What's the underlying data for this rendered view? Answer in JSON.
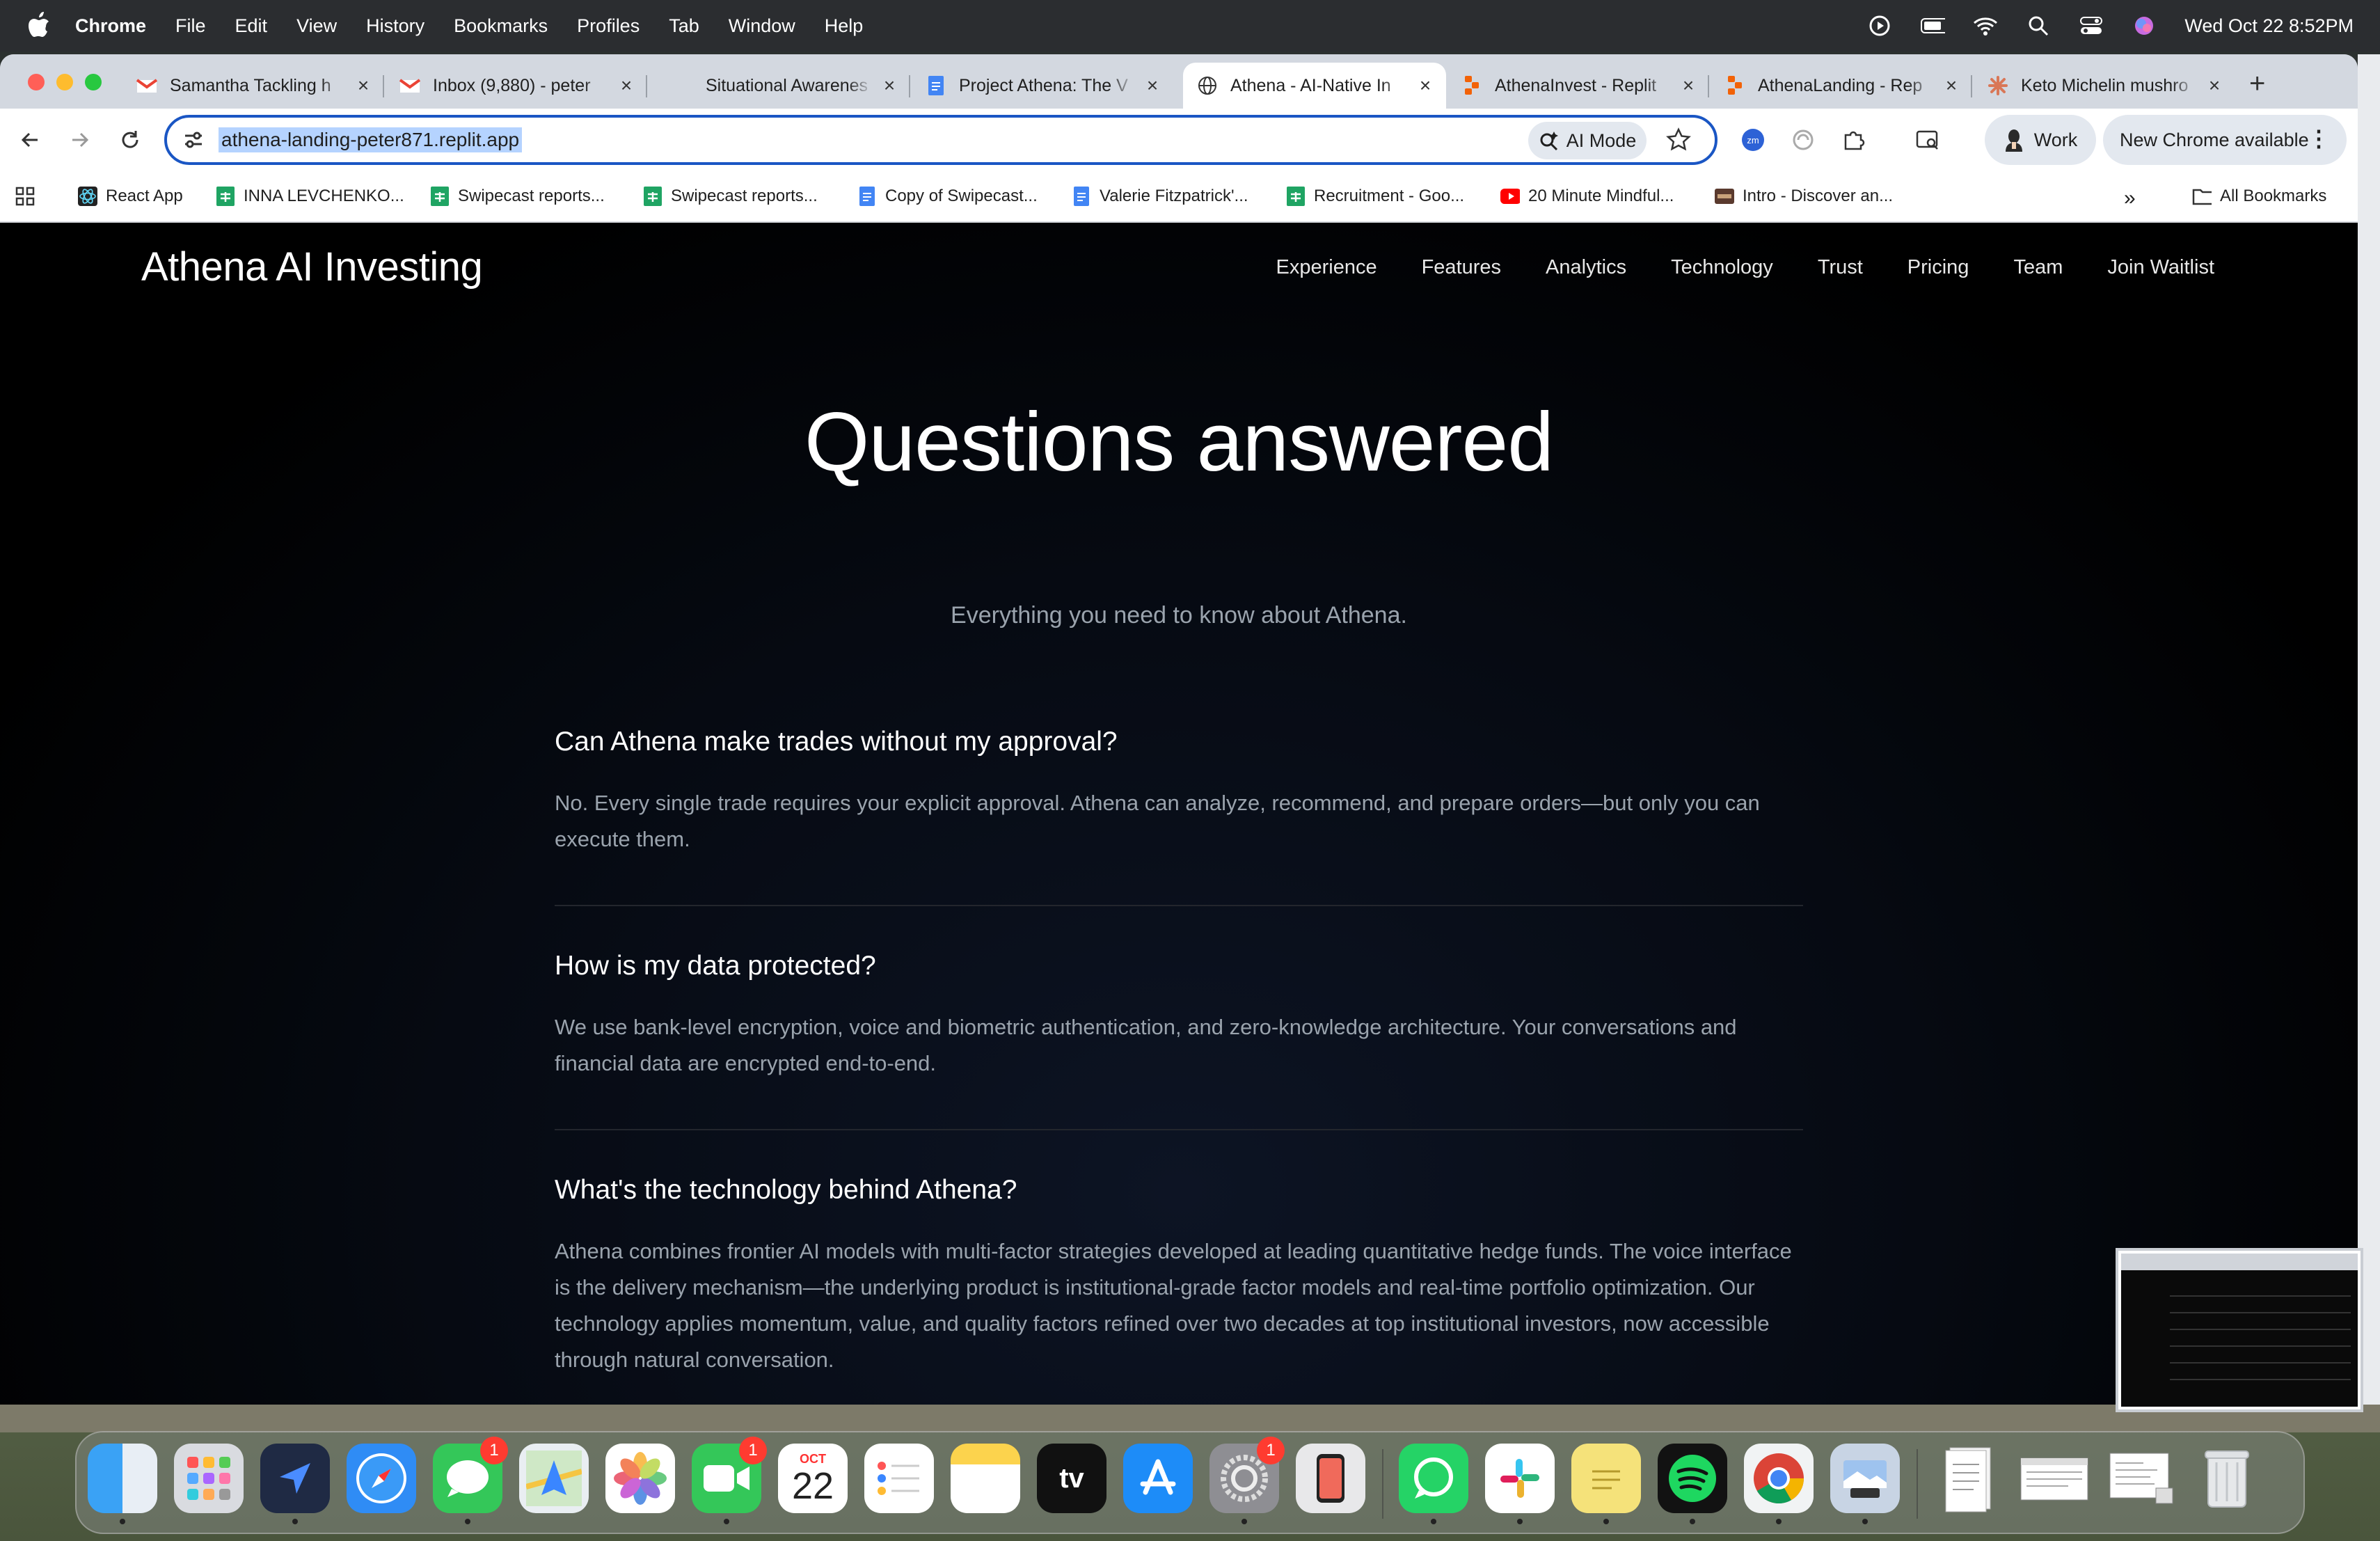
{
  "menubar": {
    "app": "Chrome",
    "items": [
      "File",
      "Edit",
      "View",
      "History",
      "Bookmarks",
      "Profiles",
      "Tab",
      "Window",
      "Help"
    ],
    "clock": "Wed Oct 22  8:52PM"
  },
  "tabs": [
    {
      "title": "Samantha Tackling h",
      "icon": "gmail-icon"
    },
    {
      "title": "Inbox (9,880) - peter",
      "icon": "gmail-icon"
    },
    {
      "title": "Situational Awarenes",
      "icon": "blank-icon"
    },
    {
      "title": "Project Athena: The V",
      "icon": "docs-icon"
    },
    {
      "title": "Athena - AI-Native In",
      "icon": "globe-icon"
    },
    {
      "title": "AthenaInvest - Replit",
      "icon": "replit-icon"
    },
    {
      "title": "AthenaLanding - Rep",
      "icon": "replit-icon"
    },
    {
      "title": "Keto Michelin mushro",
      "icon": "claude-icon"
    }
  ],
  "toolbar": {
    "url": "athena-landing-peter871.replit.app",
    "ai_mode": "AI Mode",
    "profile": "Work",
    "update": "New Chrome available"
  },
  "bookmarks": [
    {
      "label": "React App",
      "icon": "react-icon"
    },
    {
      "label": "INNA LEVCHENKO...",
      "icon": "sheets-icon"
    },
    {
      "label": "Swipecast reports...",
      "icon": "sheets-icon"
    },
    {
      "label": "Swipecast reports...",
      "icon": "sheets-icon"
    },
    {
      "label": "Copy of Swipecast...",
      "icon": "docs-icon"
    },
    {
      "label": "Valerie Fitzpatrick'...",
      "icon": "docs-icon"
    },
    {
      "label": "Recruitment - Goo...",
      "icon": "sheets-icon"
    },
    {
      "label": "20 Minute Mindful...",
      "icon": "youtube-icon"
    },
    {
      "label": "Intro - Discover an...",
      "icon": "site-icon"
    }
  ],
  "all_bookmarks": "All Bookmarks",
  "site": {
    "brand": "Athena AI Investing",
    "nav": [
      "Experience",
      "Features",
      "Analytics",
      "Technology",
      "Trust",
      "Pricing",
      "Team",
      "Join Waitlist"
    ],
    "heading": "Questions answered",
    "subheading": "Everything you need to know about Athena.",
    "faqs": [
      {
        "q": "Can Athena make trades without my approval?",
        "a": "No. Every single trade requires your explicit approval. Athena can analyze, recommend, and prepare orders—but only you can execute them."
      },
      {
        "q": "How is my data protected?",
        "a": "We use bank-level encryption, voice and biometric authentication, and zero-knowledge architecture. Your conversations and financial data are encrypted end-to-end."
      },
      {
        "q": "What's the technology behind Athena?",
        "a": "Athena combines frontier AI models with multi-factor strategies developed at leading quantitative hedge funds. The voice interface is the delivery mechanism—the underlying product is institutional-grade factor models and real-time portfolio optimization. Our technology applies momentum, value, and quality factors refined over two decades at top institutional investors, now accessible through natural conversation."
      }
    ]
  },
  "dock": {
    "calendar_month": "OCT",
    "calendar_day": "22",
    "messages_badge": "1",
    "facetime_badge": "1",
    "settings_badge": "1"
  },
  "colors": {
    "accent": "#1a56c4",
    "page_bg": "#000000",
    "answer_text": "#9aa3ad"
  }
}
